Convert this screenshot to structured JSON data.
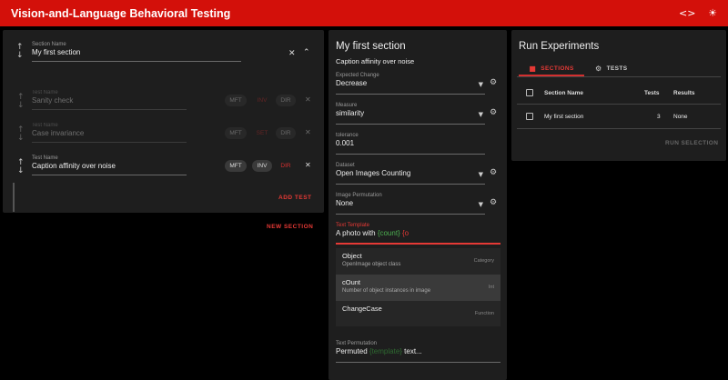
{
  "app": {
    "title": "Vision-and-Language Behavioral Testing",
    "icons": [
      "code-icon",
      "brightness-icon"
    ]
  },
  "section_editor": {
    "section_name_label": "Section Name",
    "section_name_value": "My first section",
    "test_name_label": "Test Name",
    "tests": [
      {
        "name": "Sanity check",
        "active": false,
        "selected_type": "INV"
      },
      {
        "name": "Case invariance",
        "active": false,
        "selected_type": "SET"
      },
      {
        "name": "Caption affinity over noise",
        "active": true,
        "selected_type": "DIR"
      }
    ],
    "chip_labels": {
      "mft": "MFT",
      "inv": "INV",
      "dir": "DIR"
    },
    "add_test_label": "ADD TEST"
  },
  "new_section_label": "NEW SECTION",
  "test_detail": {
    "section_title": "My first section",
    "test_title": "Caption affinity over noise",
    "fields": {
      "expected_change": {
        "label": "Expected Change",
        "value": "Decrease"
      },
      "measure": {
        "label": "Measure",
        "value": "similarity"
      },
      "tolerance": {
        "label": "tolerance",
        "value": "0.001"
      },
      "dataset": {
        "label": "Dataset",
        "value": "Open Images Counting"
      },
      "image_permutation": {
        "label": "Image Permutation",
        "value": "None"
      }
    },
    "text_template": {
      "label": "Text Template",
      "value_prefix": "A photo with ",
      "value_token": "{count}",
      "value_suffix": " {o"
    },
    "autocomplete": [
      {
        "name": "Object",
        "description": "OpenImage object class",
        "kind": "Category"
      },
      {
        "name": "cOunt",
        "description": "Number of object instances in image",
        "kind": "Int"
      },
      {
        "name": "ChangeCase",
        "description": "",
        "kind": "Function"
      }
    ],
    "text_permutation": {
      "label": "Text Permutation",
      "placeholder_prefix": "Permuted ",
      "placeholder_token": "{template}",
      "placeholder_suffix": " text..."
    }
  },
  "run_experiments": {
    "title": "Run Experiments",
    "tabs": {
      "sections": "SECTIONS",
      "tests": "TESTS"
    },
    "columns": {
      "name": "Section Name",
      "tests": "Tests",
      "results": "Results"
    },
    "rows": [
      {
        "name": "My first section",
        "tests": "3",
        "results": "None"
      }
    ],
    "run_selection_label": "RUN SELECTION"
  },
  "colors": {
    "appbar": "#d3100a",
    "accent": "#e53935",
    "token": "#4caf50",
    "card": "#1e1e1e"
  }
}
